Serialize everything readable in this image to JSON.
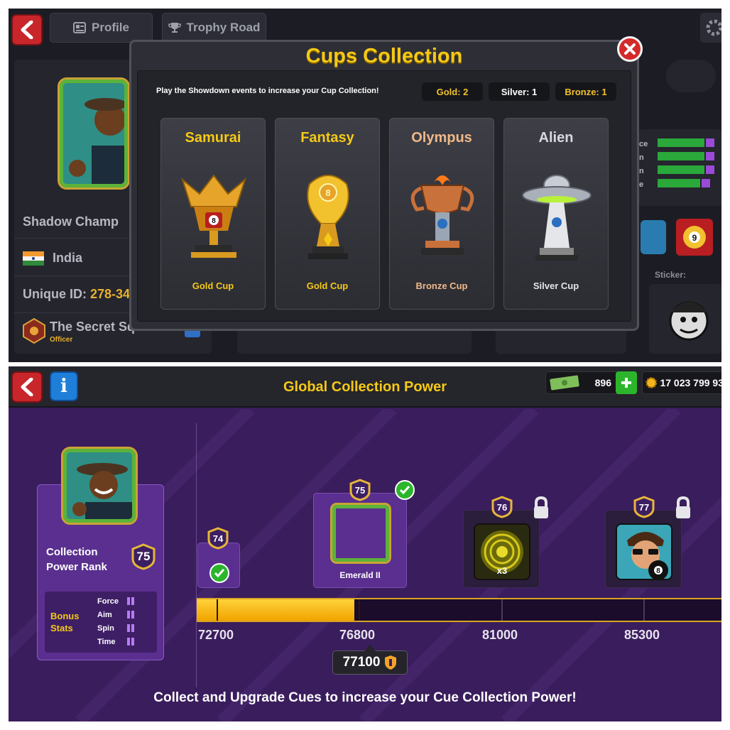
{
  "top_screen": {
    "nav": {
      "profile_tab": "Profile",
      "trophy_tab": "Trophy Road"
    },
    "profile": {
      "player_name": "Shadow Champ",
      "country": "India",
      "unique_id_label": "Unique ID:",
      "unique_id_value": "278-34",
      "club_name": "The Secret Sq",
      "club_role": "Officer"
    },
    "right_panel": {
      "stat_labels": [
        "ce",
        "n",
        "n",
        "e"
      ],
      "sticker_label": "Sticker:"
    },
    "modal": {
      "title": "Cups Collection",
      "subtitle": "Play the Showdown events to increase your Cup Collection!",
      "counts": {
        "gold": "Gold: 2",
        "silver": "Silver: 1",
        "bronze": "Bronze: 1"
      },
      "cups": [
        {
          "name": "Samurai",
          "type": "Gold Cup"
        },
        {
          "name": "Fantasy",
          "type": "Gold Cup"
        },
        {
          "name": "Olympus",
          "type": "Bronze Cup"
        },
        {
          "name": "Alien",
          "type": "Silver Cup"
        }
      ]
    }
  },
  "bottom_screen": {
    "title": "Global Collection Power",
    "cash": "896",
    "coins": "17 023 799 93",
    "rank_card": {
      "title_line1": "Collection",
      "title_line2": "Power Rank",
      "rank": "75",
      "bonus_label_1": "Bonus",
      "bonus_label_2": "Stats",
      "stats": [
        "Force",
        "Aim",
        "Spin",
        "Time"
      ]
    },
    "milestones": [
      {
        "level": "74",
        "status": "completed"
      },
      {
        "level": "75",
        "label": "Emerald II",
        "status": "completed"
      },
      {
        "level": "76",
        "reward": "x3",
        "status": "locked"
      },
      {
        "level": "77",
        "status": "locked"
      }
    ],
    "ticks": [
      "72700",
      "76800",
      "81000",
      "85300"
    ],
    "current_value": "77100",
    "progress_fraction": 0.3,
    "footer": "Collect and Upgrade Cues to increase your Cue Collection Power!"
  },
  "colors": {
    "accent_gold": "#f6c915",
    "panel_purple": "#3a1d5c",
    "dark_bg": "#1c1d24",
    "back_red": "#c8262a",
    "progress_gold": "#ffb400"
  }
}
